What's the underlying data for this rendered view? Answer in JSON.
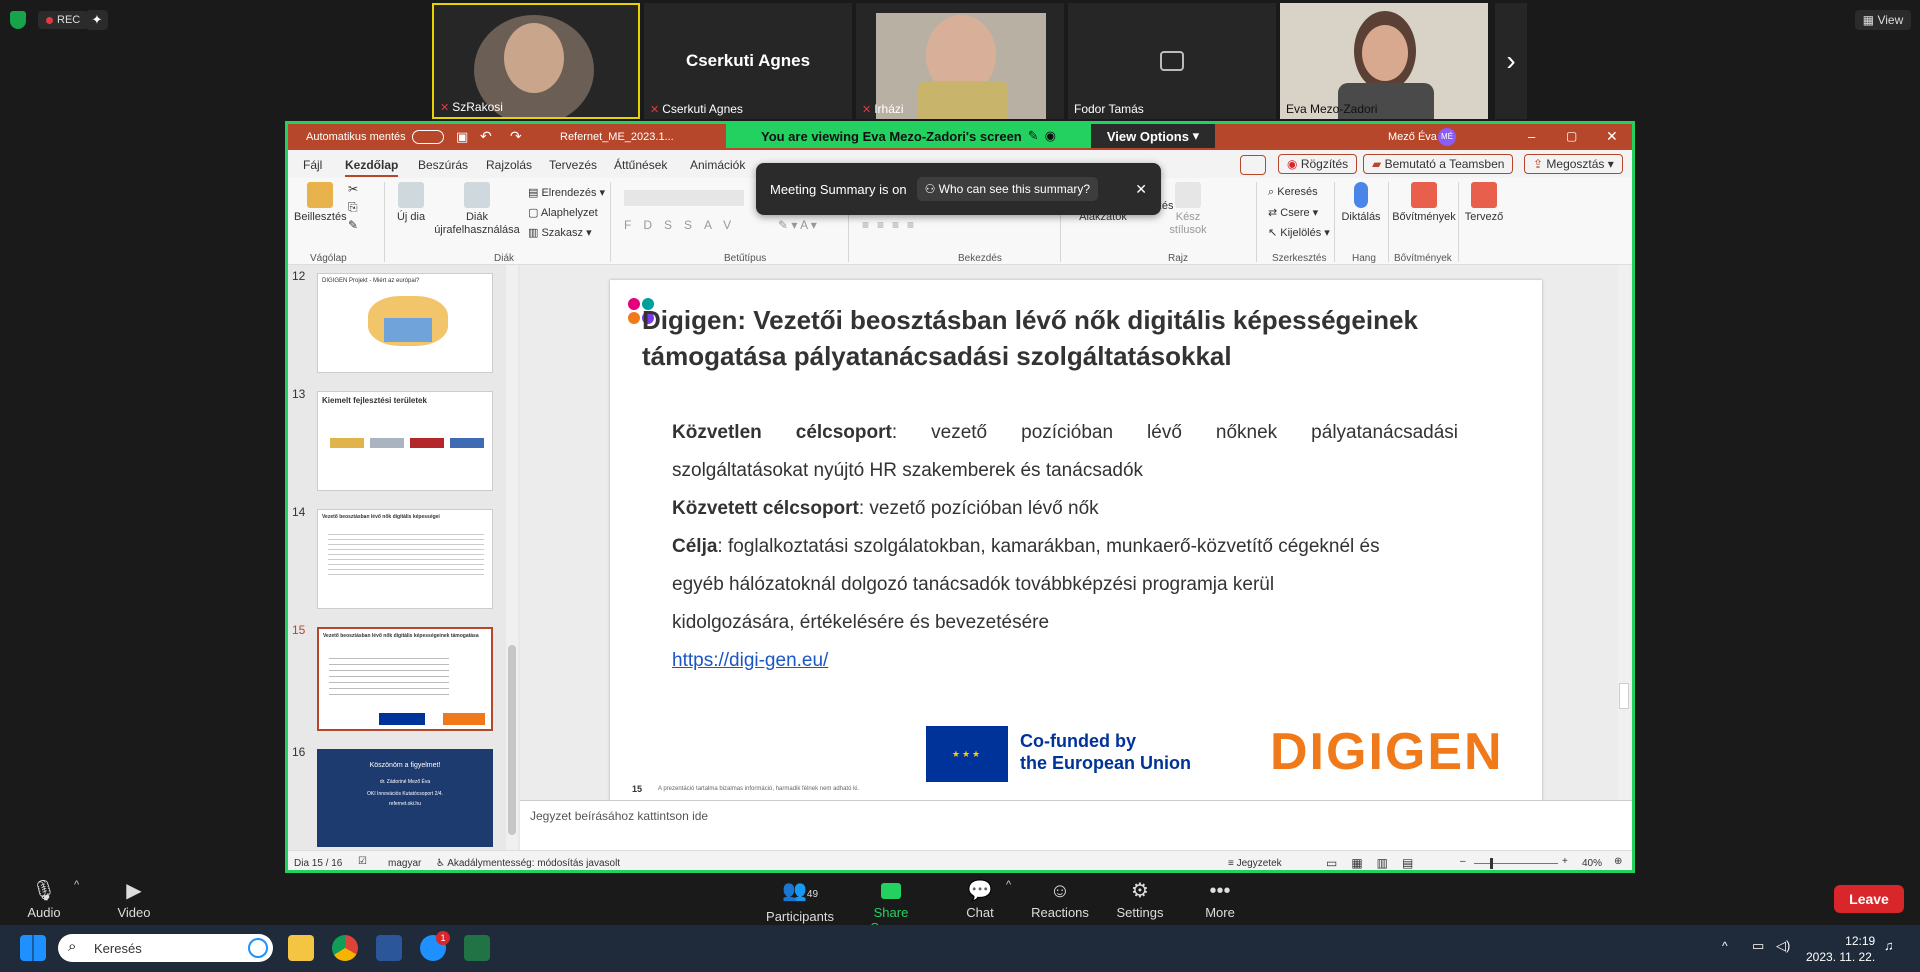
{
  "zoom_top": {
    "rec_label": "REC",
    "view_label": "View",
    "participants": [
      {
        "name": "SzRakosi"
      },
      {
        "name": "Cserkuti Agnes",
        "display": "Cserkuti Agnes"
      },
      {
        "name": "Irházi"
      },
      {
        "name": "Fodor Tamás"
      },
      {
        "name": "Eva Mezo-Zadori"
      }
    ]
  },
  "share": {
    "viewing_text": "You are viewing  Eva Mezo-Zadori's screen",
    "view_options": "View Options",
    "titlebar": {
      "autosave": "Automatikus mentés",
      "filename": "Refernet_ME_2023.1...",
      "user": "Mező Éva",
      "user_initials": "MÉ"
    },
    "tabs": [
      "Fájl",
      "Kezdőlap",
      "Beszúrás",
      "Rajzolás",
      "Tervezés",
      "Áttűnések",
      "Animációk"
    ],
    "right_buttons": {
      "record": "Rögzítés",
      "teams": "Bemutató a Teamsben",
      "share": "Megosztás"
    },
    "toast": {
      "text": "Meeting Summary is on",
      "button": "Who can see this summary?"
    },
    "ribbon": {
      "paste": "Beillesztés",
      "new_slide": "Új dia",
      "reuse": "Diák újrafelhasználása",
      "layout": "Elrendezés",
      "reset": "Alaphelyzet",
      "section": "Szakasz",
      "shapes": "Alakzatok",
      "arrange": "Elrendezés",
      "quick_styles": "Kész stílusok",
      "find": "Keresés",
      "replace": "Csere",
      "select": "Kijelölés",
      "dictate": "Diktálás",
      "addins": "Bővítmények",
      "designer": "Tervező",
      "groups": {
        "clipboard": "Vágólap",
        "slides": "Diák",
        "font": "Betűtípus",
        "paragraph": "Bekezdés",
        "drawing": "Rajz",
        "editing": "Szerkesztés",
        "voice": "Hang",
        "addins": "Bővítmények"
      }
    },
    "thumbnails": [
      {
        "num": "12",
        "title": "DIGIGEN Projekt - Miért az európai?"
      },
      {
        "num": "13",
        "title": "Kiemelt fejlesztési területek"
      },
      {
        "num": "14",
        "title": "Vezető beosztásban lévő nők digitális képességei"
      },
      {
        "num": "15",
        "title": "Vezető beosztásban lévő nők digitális képességeinek támogatása"
      },
      {
        "num": "16",
        "title": "Köszönöm a figyelmet!",
        "sub1": "dr. Zádoriné Mező Éva",
        "sub2": "OKI Innovációs Kutatócsoport 2/4.",
        "sub3": "refernet.oki.hu"
      }
    ],
    "slide": {
      "title_line1": "Digigen: Vezetői beosztásban lévő nők digitális képességeinek",
      "title_line2": "támogatása pályatanácsadási szolgáltatásokkal",
      "p1_bold": "Közvetlen célcsoport",
      "p1_rest": ": vezető pozícióban lévő nőknek pályatanácsadási",
      "p1_line2": "szolgáltatásokat nyújtó HR szakemberek és tanácsadók",
      "p2_bold": "Közvetett célcsoport",
      "p2_rest": ": vezető pozícióban lévő nők",
      "p3_bold": "Célja",
      "p3_rest": ": foglalkoztatási szolgálatokban, kamarákban, munkaerő-közvetítő cégeknél és",
      "p3_line2": "egyéb hálózatoknál dolgozó tanácsadók továbbképzési programja kerül",
      "p3_line3": "kidolgozására, értékelésére és bevezetésére",
      "link": "https://digi-gen.eu/",
      "eu_line1": "Co-funded by",
      "eu_line2": "the European Union",
      "brand": "DIGIGEN",
      "page_num": "15",
      "footer_text": "A prezentáció tartalma bizalmas információ, harmadik félnek nem adható ki."
    },
    "notes_placeholder": "Jegyzet beírásához kattintson ide",
    "status": {
      "slide_count": "Dia 15 / 16",
      "language": "magyar",
      "accessibility": "Akadálymentesség: módosítás javasolt",
      "notes": "Jegyzetek",
      "zoom": "40%"
    }
  },
  "bottom_bar": {
    "audio": "Audio",
    "video": "Video",
    "participants": "Participants",
    "participants_count": "49",
    "share_screen": "Share Screen",
    "chat": "Chat",
    "reactions": "Reactions",
    "settings": "Settings",
    "more": "More",
    "leave": "Leave"
  },
  "taskbar": {
    "search": "Keresés",
    "time": "12:19",
    "date": "2023. 11. 22.",
    "badge": "1"
  }
}
